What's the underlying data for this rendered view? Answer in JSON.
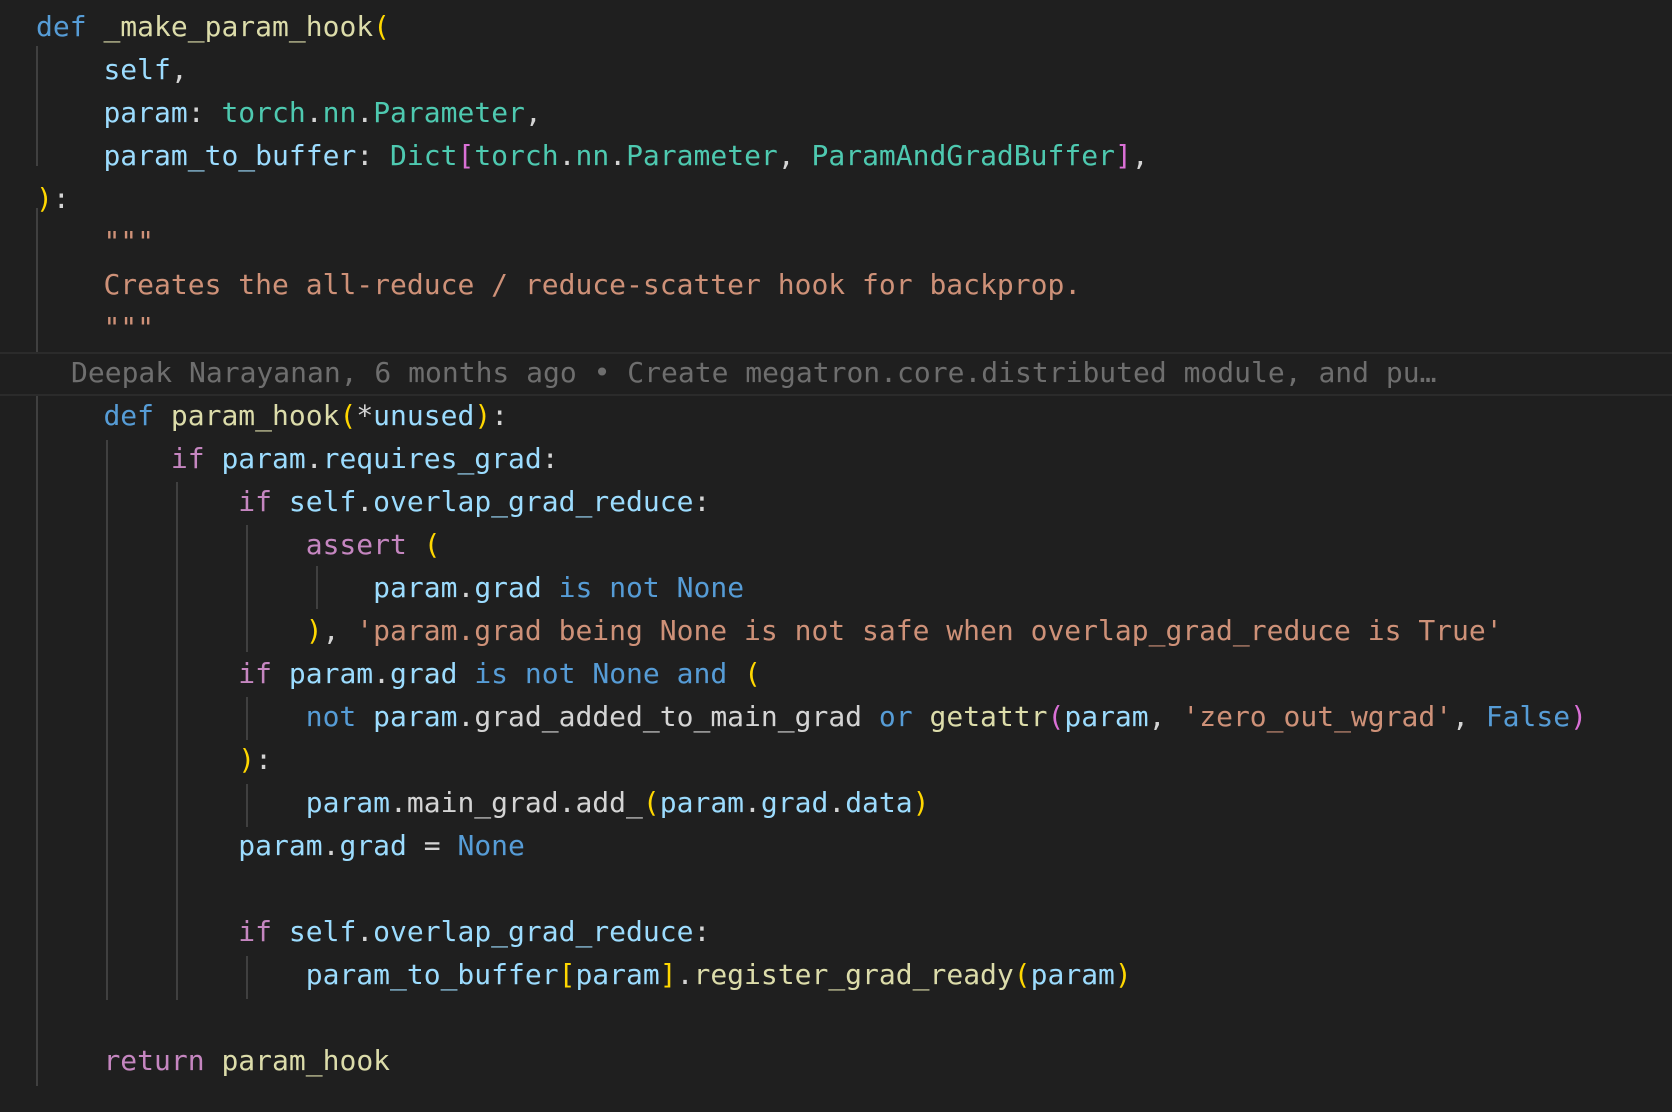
{
  "editor": {
    "language": "python",
    "blame": {
      "text": "Deepak Narayanan, 6 months ago • Create megatron.core.distributed module, and pu…"
    },
    "lines": [
      [
        [
          "kw",
          "def"
        ],
        [
          "pun",
          " "
        ],
        [
          "fn",
          "_make_param_hook"
        ],
        [
          "b1",
          "("
        ]
      ],
      [
        [
          "pun",
          "    "
        ],
        [
          "var",
          "self"
        ],
        [
          "pun",
          ","
        ]
      ],
      [
        [
          "pun",
          "    "
        ],
        [
          "var",
          "param"
        ],
        [
          "pun",
          ": "
        ],
        [
          "ty",
          "torch"
        ],
        [
          "pun",
          "."
        ],
        [
          "ty",
          "nn"
        ],
        [
          "pun",
          "."
        ],
        [
          "ty",
          "Parameter"
        ],
        [
          "pun",
          ","
        ]
      ],
      [
        [
          "pun",
          "    "
        ],
        [
          "var",
          "param_to_buffer"
        ],
        [
          "pun",
          ": "
        ],
        [
          "ty",
          "Dict"
        ],
        [
          "b2",
          "["
        ],
        [
          "ty",
          "torch"
        ],
        [
          "pun",
          "."
        ],
        [
          "ty",
          "nn"
        ],
        [
          "pun",
          "."
        ],
        [
          "ty",
          "Parameter"
        ],
        [
          "pun",
          ", "
        ],
        [
          "ty",
          "ParamAndGradBuffer"
        ],
        [
          "b2",
          "]"
        ],
        [
          "pun",
          ","
        ]
      ],
      [
        [
          "b1",
          ")"
        ],
        [
          "pun",
          ":"
        ]
      ],
      [
        [
          "pun",
          "    "
        ],
        [
          "doc",
          "\"\"\""
        ]
      ],
      [
        [
          "pun",
          "    "
        ],
        [
          "doc",
          "Creates the all-reduce / reduce-scatter hook for backprop."
        ]
      ],
      [
        [
          "pun",
          "    "
        ],
        [
          "doc",
          "\"\"\""
        ]
      ],
      [
        [
          "pun",
          "    "
        ],
        [
          "kw",
          "def"
        ],
        [
          "pun",
          " "
        ],
        [
          "fn",
          "param_hook"
        ],
        [
          "b1",
          "("
        ],
        [
          "pun",
          "*"
        ],
        [
          "var",
          "unused"
        ],
        [
          "b1",
          ")"
        ],
        [
          "pun",
          ":"
        ]
      ],
      [
        [
          "pun",
          "        "
        ],
        [
          "ctl",
          "if"
        ],
        [
          "pun",
          " "
        ],
        [
          "var",
          "param"
        ],
        [
          "pun",
          "."
        ],
        [
          "var",
          "requires_grad"
        ],
        [
          "pun",
          ":"
        ]
      ],
      [
        [
          "pun",
          "            "
        ],
        [
          "ctl",
          "if"
        ],
        [
          "pun",
          " "
        ],
        [
          "var",
          "self"
        ],
        [
          "pun",
          "."
        ],
        [
          "var",
          "overlap_grad_reduce"
        ],
        [
          "pun",
          ":"
        ]
      ],
      [
        [
          "pun",
          "                "
        ],
        [
          "ctl",
          "assert"
        ],
        [
          "pun",
          " "
        ],
        [
          "b1",
          "("
        ]
      ],
      [
        [
          "pun",
          "                    "
        ],
        [
          "var",
          "param"
        ],
        [
          "pun",
          "."
        ],
        [
          "var",
          "grad"
        ],
        [
          "pun",
          " "
        ],
        [
          "kw",
          "is"
        ],
        [
          "pun",
          " "
        ],
        [
          "kw",
          "not"
        ],
        [
          "pun",
          " "
        ],
        [
          "kw",
          "None"
        ]
      ],
      [
        [
          "pun",
          "                "
        ],
        [
          "b1",
          ")"
        ],
        [
          "pun",
          ", "
        ],
        [
          "str",
          "'param.grad being None is not safe when overlap_grad_reduce is True'"
        ]
      ],
      [
        [
          "pun",
          "            "
        ],
        [
          "ctl",
          "if"
        ],
        [
          "pun",
          " "
        ],
        [
          "var",
          "param"
        ],
        [
          "pun",
          "."
        ],
        [
          "var",
          "grad"
        ],
        [
          "pun",
          " "
        ],
        [
          "kw",
          "is"
        ],
        [
          "pun",
          " "
        ],
        [
          "kw",
          "not"
        ],
        [
          "pun",
          " "
        ],
        [
          "kw",
          "None"
        ],
        [
          "pun",
          " "
        ],
        [
          "kw",
          "and"
        ],
        [
          "pun",
          " "
        ],
        [
          "b1",
          "("
        ]
      ],
      [
        [
          "pun",
          "                "
        ],
        [
          "kw",
          "not"
        ],
        [
          "pun",
          " "
        ],
        [
          "var",
          "param"
        ],
        [
          "pun",
          "."
        ],
        [
          "pun",
          "grad_added_to_main_grad"
        ],
        [
          "pun",
          " "
        ],
        [
          "kw",
          "or"
        ],
        [
          "pun",
          " "
        ],
        [
          "fn",
          "getattr"
        ],
        [
          "b2",
          "("
        ],
        [
          "var",
          "param"
        ],
        [
          "pun",
          ", "
        ],
        [
          "str",
          "'zero_out_wgrad'"
        ],
        [
          "pun",
          ", "
        ],
        [
          "kw",
          "False"
        ],
        [
          "b2",
          ")"
        ]
      ],
      [
        [
          "pun",
          "            "
        ],
        [
          "b1",
          ")"
        ],
        [
          "pun",
          ":"
        ]
      ],
      [
        [
          "pun",
          "                "
        ],
        [
          "var",
          "param"
        ],
        [
          "pun",
          "."
        ],
        [
          "pun",
          "main_grad"
        ],
        [
          "pun",
          "."
        ],
        [
          "pun",
          "add_"
        ],
        [
          "b1",
          "("
        ],
        [
          "var",
          "param"
        ],
        [
          "pun",
          "."
        ],
        [
          "var",
          "grad"
        ],
        [
          "pun",
          "."
        ],
        [
          "var",
          "data"
        ],
        [
          "b1",
          ")"
        ]
      ],
      [
        [
          "pun",
          "            "
        ],
        [
          "var",
          "param"
        ],
        [
          "pun",
          "."
        ],
        [
          "var",
          "grad"
        ],
        [
          "pun",
          " = "
        ],
        [
          "kw",
          "None"
        ]
      ],
      [],
      [
        [
          "pun",
          "            "
        ],
        [
          "ctl",
          "if"
        ],
        [
          "pun",
          " "
        ],
        [
          "var",
          "self"
        ],
        [
          "pun",
          "."
        ],
        [
          "var",
          "overlap_grad_reduce"
        ],
        [
          "pun",
          ":"
        ]
      ],
      [
        [
          "pun",
          "                "
        ],
        [
          "var",
          "param_to_buffer"
        ],
        [
          "b1",
          "["
        ],
        [
          "var",
          "param"
        ],
        [
          "b1",
          "]"
        ],
        [
          "pun",
          "."
        ],
        [
          "fn",
          "register_grad_ready"
        ],
        [
          "b1",
          "("
        ],
        [
          "var",
          "param"
        ],
        [
          "b1",
          ")"
        ]
      ],
      [],
      [
        [
          "pun",
          "    "
        ],
        [
          "ctl",
          "return"
        ],
        [
          "pun",
          " "
        ],
        [
          "fn",
          "param_hook"
        ]
      ]
    ]
  }
}
